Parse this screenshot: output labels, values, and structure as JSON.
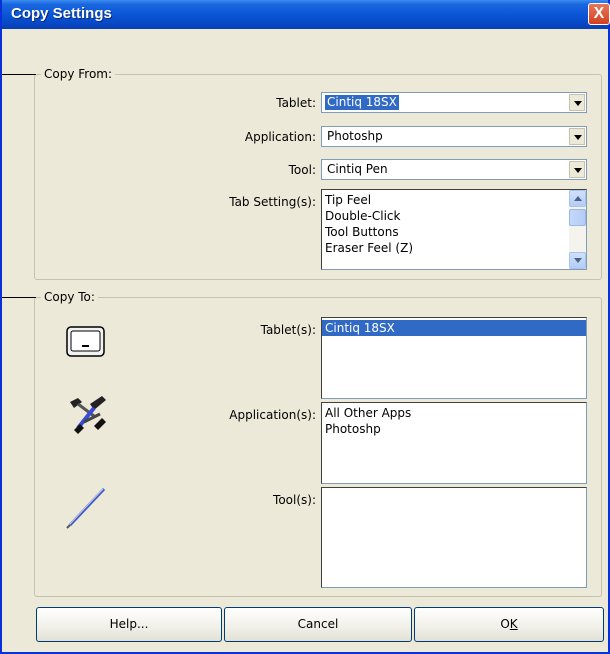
{
  "window": {
    "title": "Copy Settings",
    "close_glyph": "X"
  },
  "copy_from": {
    "group_label": "Copy From:",
    "tablet": {
      "label": "Tablet:",
      "value": "Cintiq 18SX"
    },
    "application": {
      "label": "Application:",
      "value": "Photoshp"
    },
    "tool": {
      "label": "Tool:",
      "value": "Cintiq Pen"
    },
    "tab_settings": {
      "label": "Tab Setting(s):",
      "items": [
        "Tip Feel",
        "Double-Click",
        "Tool Buttons",
        "Eraser Feel (Z)"
      ]
    }
  },
  "copy_to": {
    "group_label": "Copy To:",
    "tablets": {
      "label": "Tablet(s):",
      "items": [
        "Cintiq 18SX"
      ],
      "selected_index": 0
    },
    "applications": {
      "label": "Application(s):",
      "items": [
        "All Other Apps",
        "Photoshp"
      ]
    },
    "tools": {
      "label": "Tool(s):",
      "items": []
    },
    "icons": [
      "tablet-icon",
      "pen-tools-icon",
      "pen-icon"
    ]
  },
  "buttons": {
    "help": "Help...",
    "cancel": "Cancel",
    "ok_prefix": "O",
    "ok_underlined": "K"
  },
  "colors": {
    "titlebar": "#0a56d6",
    "selection": "#316ac5",
    "dialog_bg": "#ece9d8"
  }
}
